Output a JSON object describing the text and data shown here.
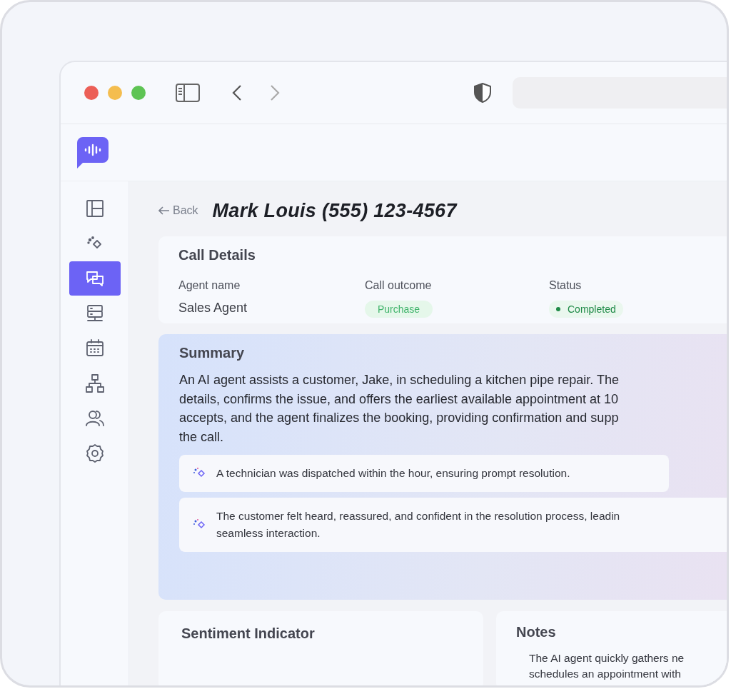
{
  "browser": {
    "traffic_lights": [
      {
        "color": "#ec5f57"
      },
      {
        "color": "#f4bd4f"
      },
      {
        "color": "#5ec454"
      }
    ]
  },
  "sidebar": {
    "items": [
      {
        "kind": "layout",
        "selected": false
      },
      {
        "kind": "sparkle",
        "selected": false
      },
      {
        "kind": "chat",
        "selected": true
      },
      {
        "kind": "server",
        "selected": false
      },
      {
        "kind": "calendar",
        "selected": false
      },
      {
        "kind": "hierarchy",
        "selected": false
      },
      {
        "kind": "users",
        "selected": false
      },
      {
        "kind": "settings",
        "selected": false
      }
    ]
  },
  "header": {
    "back": "Back",
    "title": "Mark Louis (555) 123-4567"
  },
  "call_details": {
    "title": "Call Details",
    "fields": [
      {
        "label": "Agent name",
        "value": "Sales Agent",
        "kind": "text"
      },
      {
        "label": "Call outcome",
        "value": "Purchase",
        "kind": "pill"
      },
      {
        "label": "Status",
        "value": "Completed",
        "kind": "status"
      }
    ]
  },
  "summary": {
    "title": "Summary",
    "lines": [
      "An AI agent assists a customer, Jake, in scheduling a kitchen pipe repair. The",
      "details, confirms the issue, and offers the earliest available appointment at 10",
      "accepts, and the agent finalizes the booking, providing confirmation and supp",
      "the call."
    ],
    "insights": [
      {
        "lines": [
          "A technician was dispatched within the hour, ensuring prompt resolution."
        ]
      },
      {
        "lines": [
          "The customer felt heard, reassured, and confident in the resolution process, leadin",
          "seamless interaction."
        ]
      }
    ]
  },
  "sentiment": {
    "title": "Sentiment Indicator"
  },
  "notes": {
    "title": "Notes",
    "lines": [
      "The AI agent quickly gathers ne",
      "schedules an appointment with"
    ]
  }
}
